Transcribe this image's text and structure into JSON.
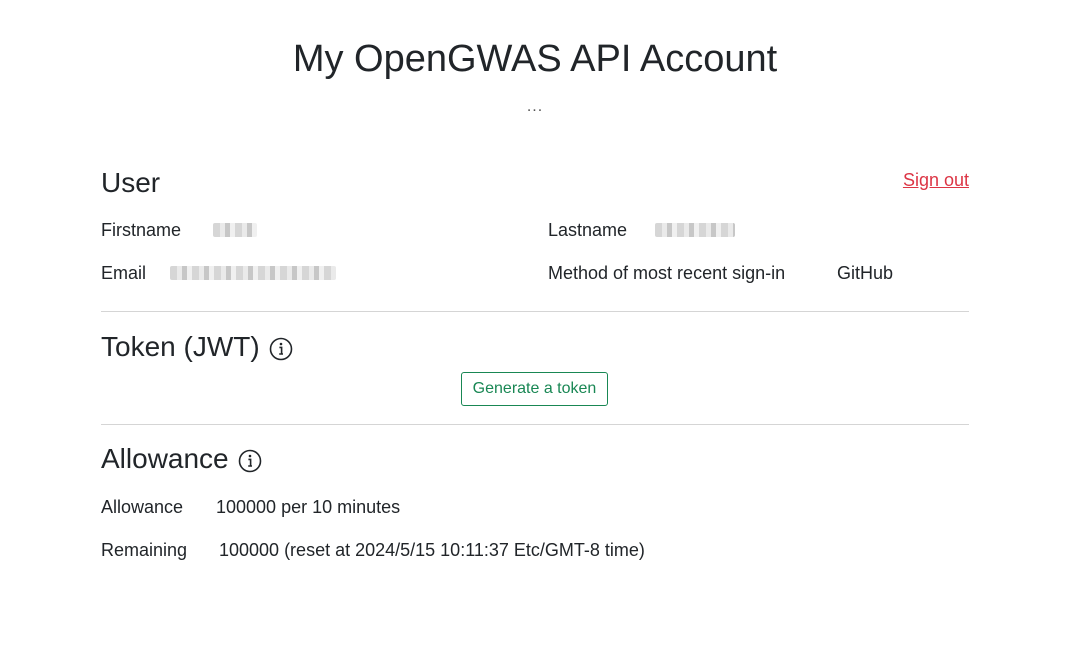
{
  "page": {
    "title": "My OpenGWAS API Account",
    "subtitle": "..."
  },
  "user": {
    "heading": "User",
    "sign_out_label": "Sign out",
    "firstname_label": "Firstname",
    "lastname_label": "Lastname",
    "email_label": "Email",
    "signin_method_label": "Method of most recent sign-in",
    "signin_method_value": "GitHub"
  },
  "token": {
    "heading": "Token (JWT)",
    "info_icon": "info-icon",
    "generate_label": "Generate a token"
  },
  "allowance": {
    "heading": "Allowance",
    "info_icon": "info-icon",
    "allowance_label": "Allowance",
    "allowance_value": "100000 per 10 minutes",
    "remaining_label": "Remaining",
    "remaining_value": "100000 (reset at 2024/5/15 10:11:37 Etc/GMT-8 time)"
  },
  "colors": {
    "sign_out": "#dc3545",
    "button_accent": "#198754",
    "divider": "#d5d5d5"
  }
}
